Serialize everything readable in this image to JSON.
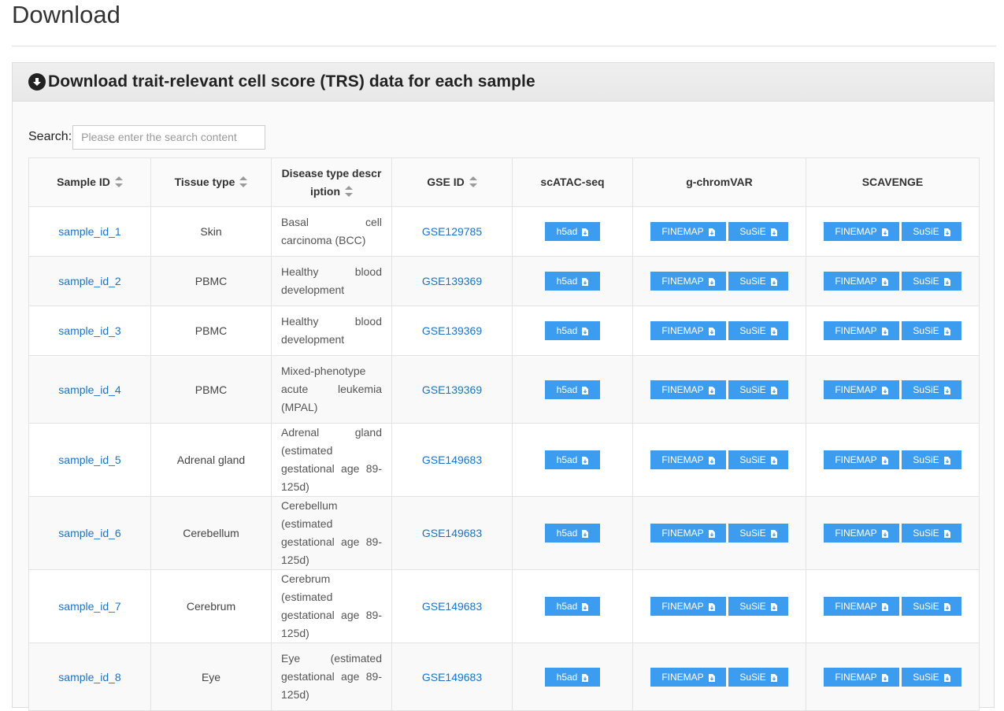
{
  "page": {
    "title": "Download"
  },
  "panel": {
    "heading": "Download trait-relevant cell score (TRS) data for each sample",
    "heading_icon": "download-circle-icon"
  },
  "search": {
    "label": "Search:",
    "placeholder": "Please enter the search content",
    "value": ""
  },
  "table": {
    "headers": {
      "sample_id": "Sample ID",
      "tissue_type": "Tissue type",
      "disease_desc": "Disease type description",
      "gse_id": "GSE ID",
      "scatac": "scATAC-seq",
      "gchromvar": "g-chromVAR",
      "scavenge": "SCAVENGE"
    },
    "button_labels": {
      "h5ad": "h5ad",
      "finemap": "FINEMAP",
      "susie": "SuSiE"
    },
    "button_icon": "file-download-icon",
    "rows": [
      {
        "sample_id": "sample_id_1",
        "tissue": "Skin",
        "desc": "Basal cell carcinoma (BCC)",
        "gse": "GSE129785"
      },
      {
        "sample_id": "sample_id_2",
        "tissue": "PBMC",
        "desc": "Healthy blood development",
        "gse": "GSE139369"
      },
      {
        "sample_id": "sample_id_3",
        "tissue": "PBMC",
        "desc": "Healthy blood development",
        "gse": "GSE139369"
      },
      {
        "sample_id": "sample_id_4",
        "tissue": "PBMC",
        "desc": "Mixed-phenotype acute leukemia (MPAL)",
        "gse": "GSE139369"
      },
      {
        "sample_id": "sample_id_5",
        "tissue": "Adrenal gland",
        "desc": "Adrenal gland (estimated gestational age 89-125d)",
        "gse": "GSE149683"
      },
      {
        "sample_id": "sample_id_6",
        "tissue": "Cerebellum",
        "desc": "Cerebellum (estimated gestational age 89-125d)",
        "gse": "GSE149683"
      },
      {
        "sample_id": "sample_id_7",
        "tissue": "Cerebrum",
        "desc": "Cerebrum (estimated gestational age 89-125d)",
        "gse": "GSE149683"
      },
      {
        "sample_id": "sample_id_8",
        "tissue": "Eye",
        "desc": "Eye (estimated gestational age 89-125d)",
        "gse": "GSE149683"
      }
    ]
  },
  "colors": {
    "link": "#1a73c7",
    "button": "#3c9cf0",
    "panel_heading": "#ececec"
  }
}
